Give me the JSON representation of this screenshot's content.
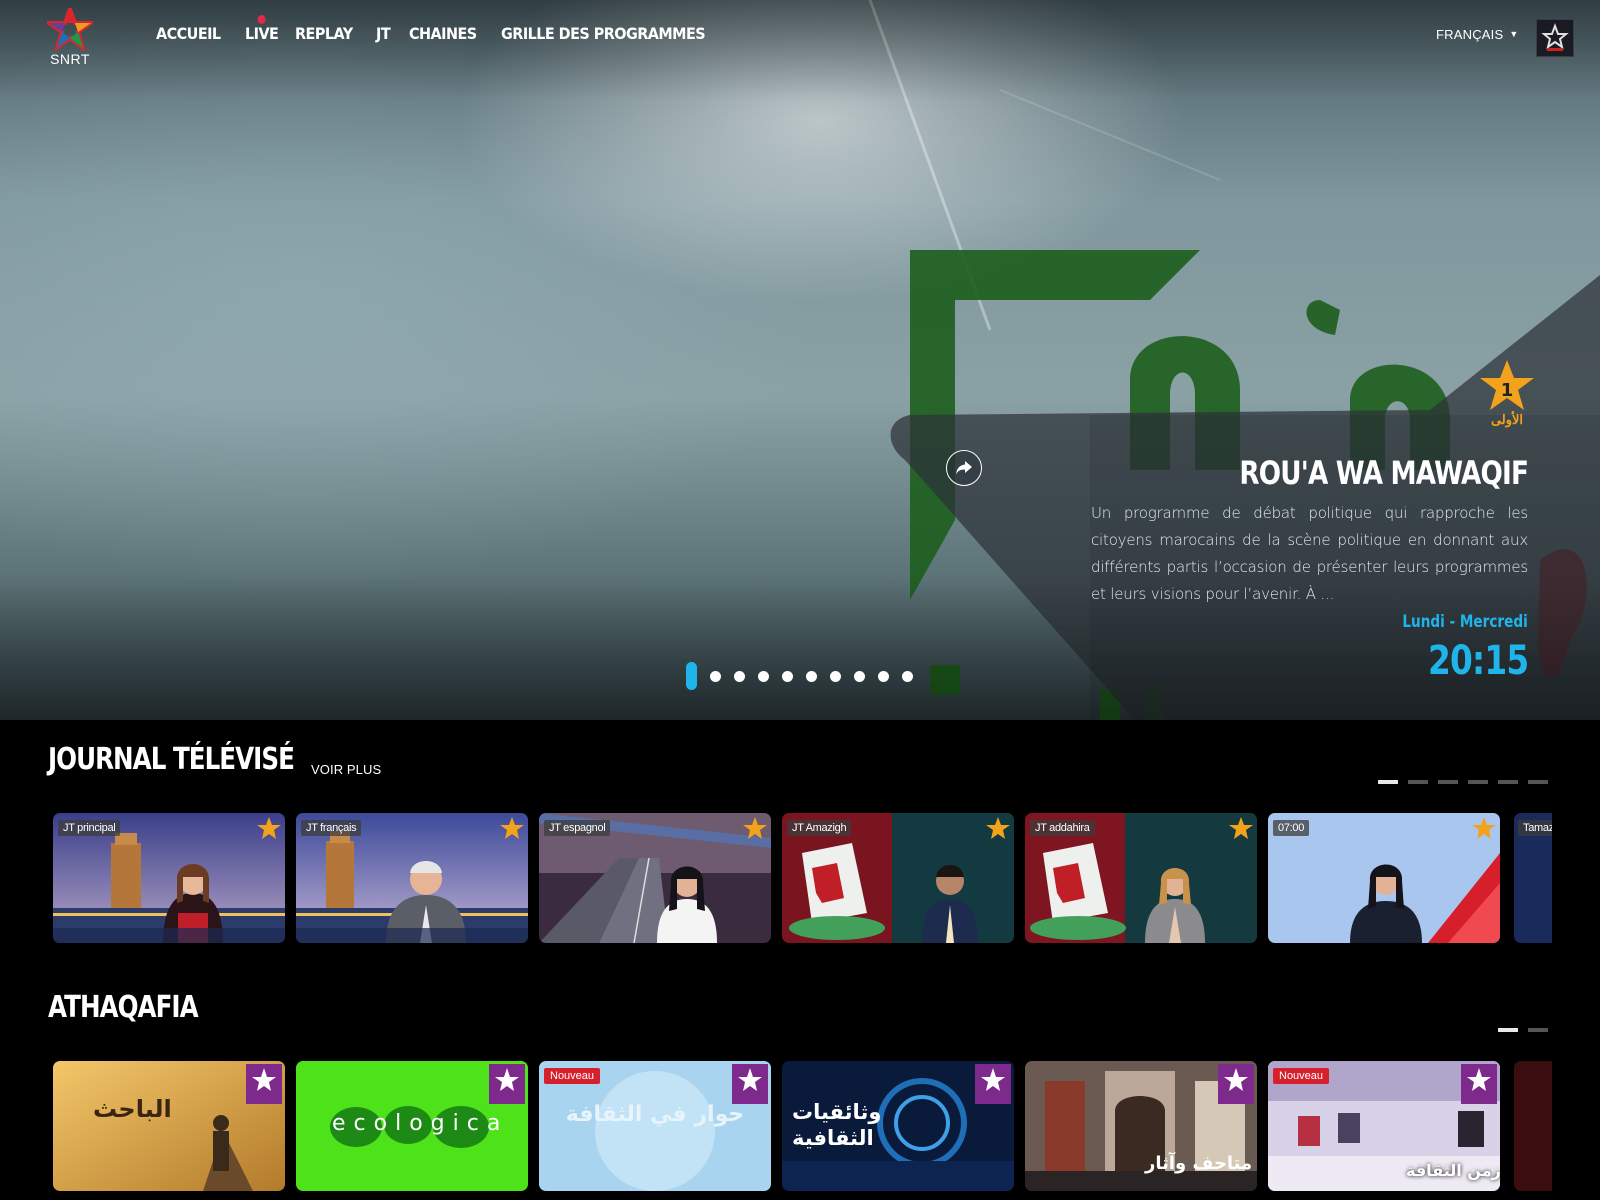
{
  "header": {
    "logo_text": "SNRT",
    "nav": [
      "ACCUEIL",
      "LIVE",
      "REPLAY",
      "JT",
      "CHAINES",
      "GRILLE DES PROGRAMMES"
    ],
    "language": "FRANÇAIS"
  },
  "hero": {
    "title": "ROU'A WA MAWAQIF",
    "description": "Un programme de débat politique qui rapproche les citoyens marocains de la scène politique en donnant aux différents partis l’occasion de présenter leurs programmes et leurs visions pour l’avenir. À ...",
    "days": "Lundi - Mercredi",
    "time": "20:15",
    "channel_logo_text": "الأولى",
    "slide_count": 10,
    "active_slide": 0,
    "accent_color": "#1fb5ea"
  },
  "journal": {
    "title": "JOURNAL TÉLÉVISÉ",
    "more_label": "VOIR PLUS",
    "pages": 6,
    "active_page": 0,
    "cards": [
      {
        "tag": "JT principal"
      },
      {
        "tag": "JT français"
      },
      {
        "tag": "JT espagnol"
      },
      {
        "tag": "JT Amazigh"
      },
      {
        "tag": "JT addahira"
      },
      {
        "tag": "07:00"
      }
    ],
    "peek_tag": "Tamazi"
  },
  "athaqafia": {
    "title": "ATHAQAFIA",
    "pages": 2,
    "active_page": 0,
    "badge_new": "Nouveau",
    "cards": [
      {
        "text": "الباحث"
      },
      {
        "text": "ecologica"
      },
      {
        "text": "حوار في الثقافة"
      },
      {
        "text": "وثائقيات الثقافية"
      },
      {
        "text": "متاحف وآثار"
      },
      {
        "text": "زمن الثقافة"
      }
    ]
  }
}
